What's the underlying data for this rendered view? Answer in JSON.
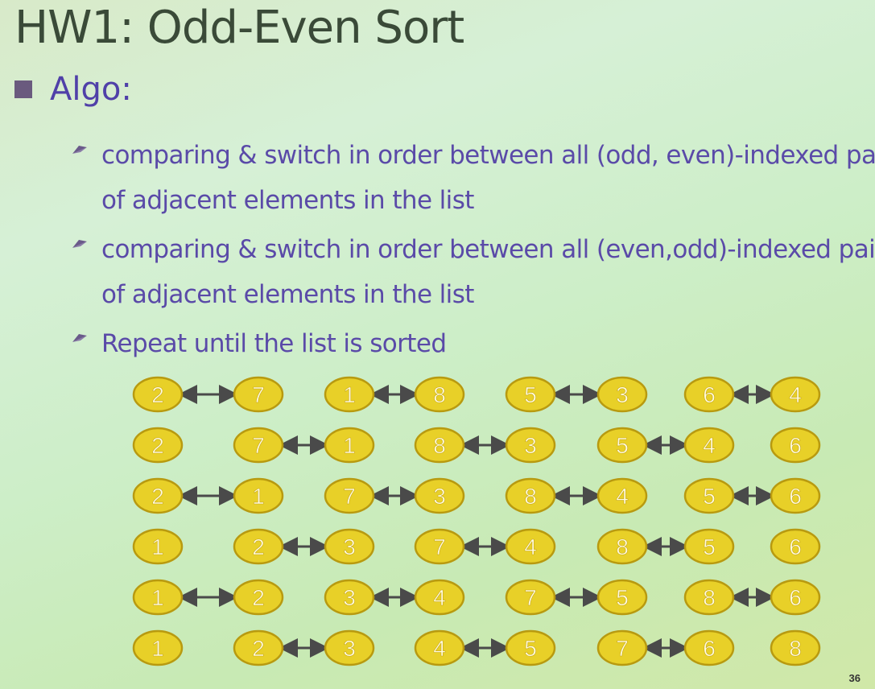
{
  "slide": {
    "title": "HW1: Odd-Even Sort",
    "bullet": "Algo:",
    "sub_items": [
      "comparing & switch in order between all (odd, even)-indexed pairs of adjacent elements in the list",
      "comparing & switch in order between all (even,odd)-indexed pairs of adjacent elements in the list",
      "Repeat until the list is sorted"
    ],
    "page_number": "36"
  },
  "sort_rows": [
    {
      "values": [
        "2",
        "7",
        "1",
        "8",
        "5",
        "3",
        "6",
        "4"
      ],
      "pairs": [
        [
          0,
          1
        ],
        [
          2,
          3
        ],
        [
          4,
          5
        ],
        [
          6,
          7
        ]
      ]
    },
    {
      "values": [
        "2",
        "7",
        "1",
        "8",
        "3",
        "5",
        "4",
        "6"
      ],
      "pairs": [
        [
          1,
          2
        ],
        [
          3,
          4
        ],
        [
          5,
          6
        ]
      ]
    },
    {
      "values": [
        "2",
        "1",
        "7",
        "3",
        "8",
        "4",
        "5",
        "6"
      ],
      "pairs": [
        [
          0,
          1
        ],
        [
          2,
          3
        ],
        [
          4,
          5
        ],
        [
          6,
          7
        ]
      ]
    },
    {
      "values": [
        "1",
        "2",
        "3",
        "7",
        "4",
        "8",
        "5",
        "6"
      ],
      "pairs": [
        [
          1,
          2
        ],
        [
          3,
          4
        ],
        [
          5,
          6
        ]
      ]
    },
    {
      "values": [
        "1",
        "2",
        "3",
        "4",
        "7",
        "5",
        "8",
        "6"
      ],
      "pairs": [
        [
          0,
          1
        ],
        [
          2,
          3
        ],
        [
          4,
          5
        ],
        [
          6,
          7
        ]
      ]
    },
    {
      "values": [
        "1",
        "2",
        "3",
        "4",
        "5",
        "7",
        "6",
        "8"
      ],
      "pairs": [
        [
          1,
          2
        ],
        [
          3,
          4
        ],
        [
          5,
          6
        ]
      ]
    }
  ],
  "colors": {
    "title": "#3a4a38",
    "bullet_text": "#5040a8",
    "node_fill": "#e8d028",
    "node_stroke": "#b89a10",
    "node_text": "#fffbe0",
    "arrow": "#4a4a4a"
  }
}
